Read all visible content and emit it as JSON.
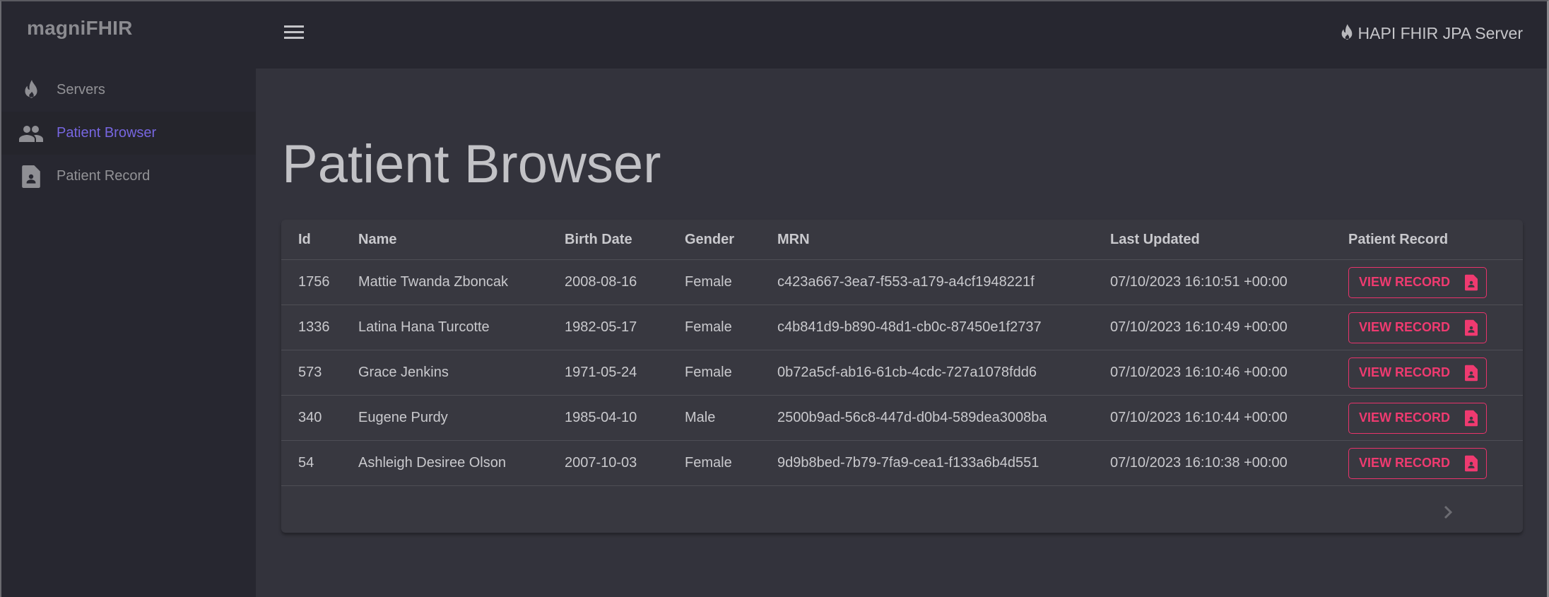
{
  "app": {
    "logo": "magniFHIR",
    "server_name": "HAPI FHIR JPA Server"
  },
  "sidebar": {
    "items": [
      {
        "label": "Servers",
        "icon": "flame-icon",
        "active": false
      },
      {
        "label": "Patient Browser",
        "icon": "people-icon",
        "active": true
      },
      {
        "label": "Patient Record",
        "icon": "patient-file-icon",
        "active": false
      }
    ]
  },
  "colors": {
    "accent_nav": "#7766e0",
    "accent_button": "#ef3a70"
  },
  "main": {
    "title": "Patient Browser",
    "table": {
      "columns": [
        "Id",
        "Name",
        "Birth Date",
        "Gender",
        "MRN",
        "Last Updated",
        "Patient Record"
      ],
      "rows": [
        {
          "id": "1756",
          "name": "Mattie Twanda Zboncak",
          "birth_date": "2008-08-16",
          "gender": "Female",
          "mrn": "c423a667-3ea7-f553-a179-a4cf1948221f",
          "last_updated": "07/10/2023 16:10:51 +00:00",
          "action": "VIEW RECORD"
        },
        {
          "id": "1336",
          "name": "Latina Hana Turcotte",
          "birth_date": "1982-05-17",
          "gender": "Female",
          "mrn": "c4b841d9-b890-48d1-cb0c-87450e1f2737",
          "last_updated": "07/10/2023 16:10:49 +00:00",
          "action": "VIEW RECORD"
        },
        {
          "id": "573",
          "name": "Grace Jenkins",
          "birth_date": "1971-05-24",
          "gender": "Female",
          "mrn": "0b72a5cf-ab16-61cb-4cdc-727a1078fdd6",
          "last_updated": "07/10/2023 16:10:46 +00:00",
          "action": "VIEW RECORD"
        },
        {
          "id": "340",
          "name": "Eugene Purdy",
          "birth_date": "1985-04-10",
          "gender": "Male",
          "mrn": "2500b9ad-56c8-447d-d0b4-589dea3008ba",
          "last_updated": "07/10/2023 16:10:44 +00:00",
          "action": "VIEW RECORD"
        },
        {
          "id": "54",
          "name": "Ashleigh Desiree Olson",
          "birth_date": "2007-10-03",
          "gender": "Female",
          "mrn": "9d9b8bed-7b79-7fa9-cea1-f133a6b4d551",
          "last_updated": "07/10/2023 16:10:38 +00:00",
          "action": "VIEW RECORD"
        }
      ]
    },
    "pagination": {
      "next_icon": "chevron-right-icon"
    }
  }
}
